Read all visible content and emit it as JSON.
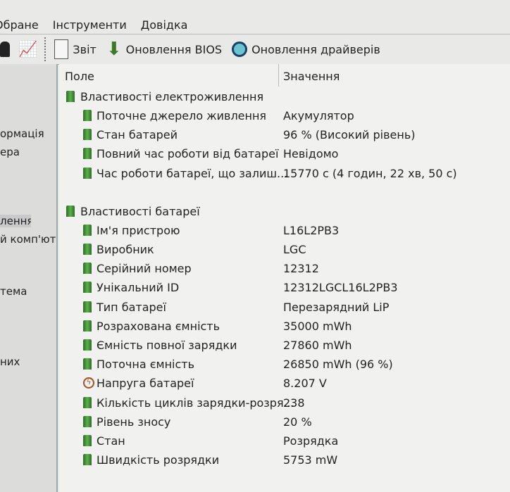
{
  "menu": [
    "Обране",
    "Інструменти",
    "Довідка"
  ],
  "toolbar": {
    "report": "Звіт",
    "bios": "Оновлення BIOS",
    "drivers": "Оновлення драйверів"
  },
  "sidebar": [
    "ормація",
    "ера",
    "лення",
    "й комп'ют",
    "тема",
    "них"
  ],
  "header": {
    "field": "Поле",
    "value": "Значення"
  },
  "groups": [
    {
      "title": "Властивості електроживлення",
      "rows": [
        {
          "field": "Поточне джерело живлення",
          "value": "Акумулятор"
        },
        {
          "field": "Стан батарей",
          "value": "96 % (Високий рівень)"
        },
        {
          "field": "Повний час роботи від батареї",
          "value": "Невідомо"
        },
        {
          "field": "Час роботи батареї, що залиш...",
          "value": "15770 с (4 годин, 22 хв, 50 с)"
        }
      ]
    },
    {
      "title": "Властивості батареї",
      "rows": [
        {
          "field": "Ім'я пристрою",
          "value": "L16L2PB3"
        },
        {
          "field": "Виробник",
          "value": "LGC"
        },
        {
          "field": "Серійний номер",
          "value": "12312"
        },
        {
          "field": "Унікальний ID",
          "value": "12312LGCL16L2PB3"
        },
        {
          "field": "Тип батареї",
          "value": "Перезарядний LiP"
        },
        {
          "field": "Розрахована ємність",
          "value": "35000 mWh"
        },
        {
          "field": "Ємність повної зарядки",
          "value": "27860 mWh"
        },
        {
          "field": "Поточна ємність",
          "value": "26850 mWh  (96 %)"
        },
        {
          "field": "Напруга батареї",
          "value": "8.207 V"
        },
        {
          "field": "Кількість циклів зарядки-розря...",
          "value": "238"
        },
        {
          "field": "Рівень зносу",
          "value": "20 %"
        },
        {
          "field": "Стан",
          "value": "Розрядка"
        },
        {
          "field": "Швидкість розрядки",
          "value": "5753 mW"
        }
      ]
    }
  ]
}
